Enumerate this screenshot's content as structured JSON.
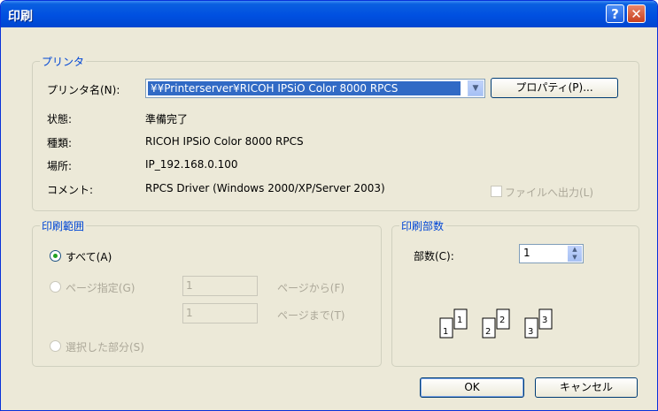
{
  "window": {
    "title": "印刷"
  },
  "titlebar": {
    "help_glyph": "?",
    "close_glyph": "✕"
  },
  "printer": {
    "legend": "プリンタ",
    "name_label": "プリンタ名(N):",
    "name_value": "¥¥Printerserver¥RICOH IPSiO Color 8000 RPCS",
    "properties_button": "プロパティ(P)...",
    "status_label": "状態:",
    "status_value": "準備完了",
    "type_label": "種類:",
    "type_value": "RICOH IPSiO Color 8000 RPCS",
    "location_label": "場所:",
    "location_value": "IP_192.168.0.100",
    "comment_label": "コメント:",
    "comment_value": "RPCS Driver (Windows 2000/XP/Server 2003)",
    "print_to_file_label": "ファイルへ出力(L)"
  },
  "range": {
    "legend": "印刷範囲",
    "all_label": "すべて(A)",
    "pages_label": "ページ指定(G)",
    "from_value": "1",
    "from_label": "ページから(F)",
    "to_value": "1",
    "to_label": "ページまで(T)",
    "selection_label": "選択した部分(S)"
  },
  "copies": {
    "legend": "印刷部数",
    "count_label": "部数(C):",
    "count_value": "1",
    "collate_icon": "collate-pages-icon"
  },
  "buttons": {
    "ok": "OK",
    "cancel": "キャンセル"
  },
  "colors": {
    "titlebar": "#0054e3",
    "dialog_bg": "#ece9d8",
    "group_label": "#0046d5",
    "selection": "#316ac5"
  }
}
